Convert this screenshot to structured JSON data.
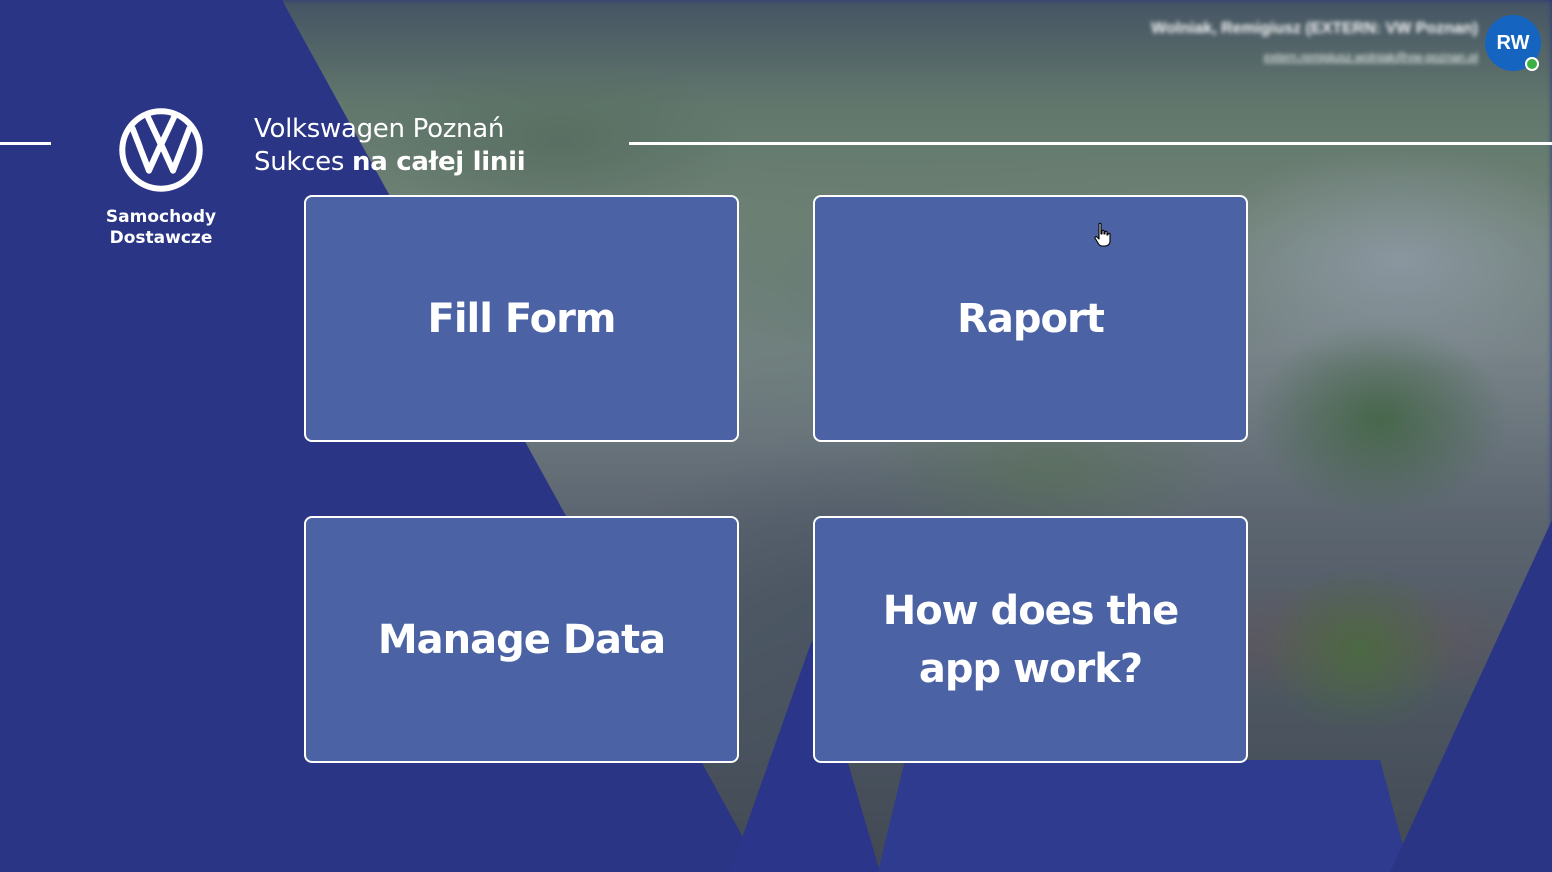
{
  "colors": {
    "brand_navy": "#2a3586",
    "tile_fill": "#4b63a4",
    "tile_border": "#ffffff",
    "avatar_bg": "#1565c0",
    "presence": "#3cb043"
  },
  "brand": {
    "logo_icon": "vw-logo-icon",
    "sub_line1": "Samochody",
    "sub_line2": "Dostawcze",
    "tagline_line1": "Volkswagen Poznań",
    "tagline_line2_regular": "Sukces ",
    "tagline_line2_bold": "na całej linii"
  },
  "user": {
    "name": "Wolniak, Remigiusz (EXTERN: VW Poznan)",
    "email": "extern.remigiusz.wolniak@vw-poznan.pl",
    "initials": "RW",
    "status_icon": "presence-available-icon"
  },
  "tiles": [
    {
      "label": "Fill Form"
    },
    {
      "label": "Raport"
    },
    {
      "label": "Manage Data"
    },
    {
      "label": "How does the app work?"
    }
  ],
  "cursor": {
    "icon": "hand-pointer-icon"
  }
}
